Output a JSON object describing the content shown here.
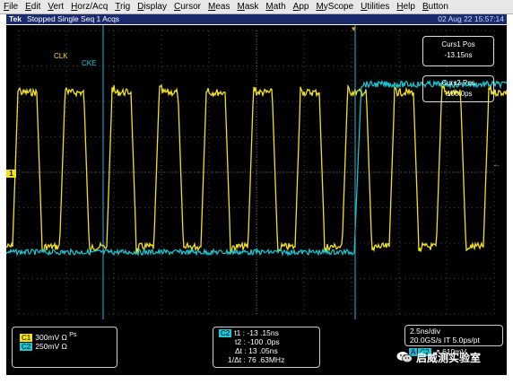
{
  "menu": [
    "File",
    "Edit",
    "Vert",
    "Horz/Acq",
    "Trig",
    "Display",
    "Cursor",
    "Meas",
    "Mask",
    "Math",
    "App",
    "MyScope",
    "Utilities",
    "Help",
    "Button"
  ],
  "status": {
    "brand": "Tek",
    "mode": "Stopped Single Seq 1 Acqs",
    "datetime": "02 Aug 22 15:57:14"
  },
  "cursors": {
    "curs1": {
      "title": "Curs1 Pos",
      "value": "-13.15ns"
    },
    "curs2": {
      "title": "Curs2 Pos",
      "value": "-100.0ps"
    }
  },
  "labels": {
    "clk": "CLK",
    "cke": "CKE",
    "ch1_marker": "1"
  },
  "channels_panel": {
    "c1": {
      "name": "C1",
      "value": "300mV Ω",
      "extra": "Ps"
    },
    "c2": {
      "name": "C2",
      "value": "250mV Ω"
    }
  },
  "meas_panel": {
    "chip": "C2",
    "t1": "t1 :   -13 .15ns",
    "t2": "t2 : -100 .0ps",
    "dt": "Δt :     13 .05ns",
    "inv": "1/Δt :   76 .63MHz"
  },
  "timebase": {
    "div": "2.5ns/div",
    "rate": "20.0GS/s IT 5.0ps/pt",
    "trig_chip": "A",
    "trig_ch": "C2",
    "trig_level": "610mV"
  },
  "watermark": {
    "text": "启威测实验室"
  },
  "colors": {
    "ch1": "#f2e21a",
    "ch2": "#19c9d6",
    "cursor": "#2bb3d6"
  }
}
